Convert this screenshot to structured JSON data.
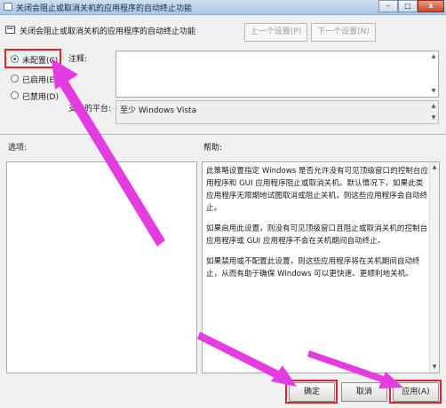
{
  "window": {
    "title": "关闭会阻止或取消关机的应用程序的自动终止功能",
    "buttons": {
      "minimize": "–",
      "maximize": "□",
      "close": "x"
    }
  },
  "header": {
    "title": "关闭会阻止或取消关机的应用程序的自动终止功能",
    "prev_label": "上一个设置(P)",
    "next_label": "下一个设置(N)"
  },
  "radios": [
    {
      "label": "未配置(C)",
      "checked": true
    },
    {
      "label": "已启用(E)",
      "checked": false
    },
    {
      "label": "已禁用(D)",
      "checked": false
    }
  ],
  "fields": {
    "comment_label": "注释:",
    "comment_value": "",
    "platform_label": "支持的平台:",
    "platform_value": "至少 Windows Vista"
  },
  "sections": {
    "options_label": "选项:",
    "help_label": "帮助:"
  },
  "help": {
    "paragraphs": [
      "此策略设置指定 Windows 是否允许没有可见顶级窗口的控制台应用程序和 GUI 应用程序阻止或取消关机。默认情况下，如果此类应用程序无限期地试图取消或阻止关机，则这些应用程序会自动终止。",
      "如果启用此设置，则没有可见顶级窗口且阻止或取消关机的控制台应用程序或 GUI 应用程序不会在关机期间自动终止。",
      "如果禁用或不配置此设置，则这些应用程序将在关机期间自动终止，从而有助于确保 Windows 可以更快速、更顺利地关机。"
    ]
  },
  "footer": {
    "ok_label": "确定",
    "cancel_label": "取消",
    "apply_label": "应用(A)"
  },
  "annotation_color": "#e8202a",
  "arrow_color": "#e33ce0"
}
